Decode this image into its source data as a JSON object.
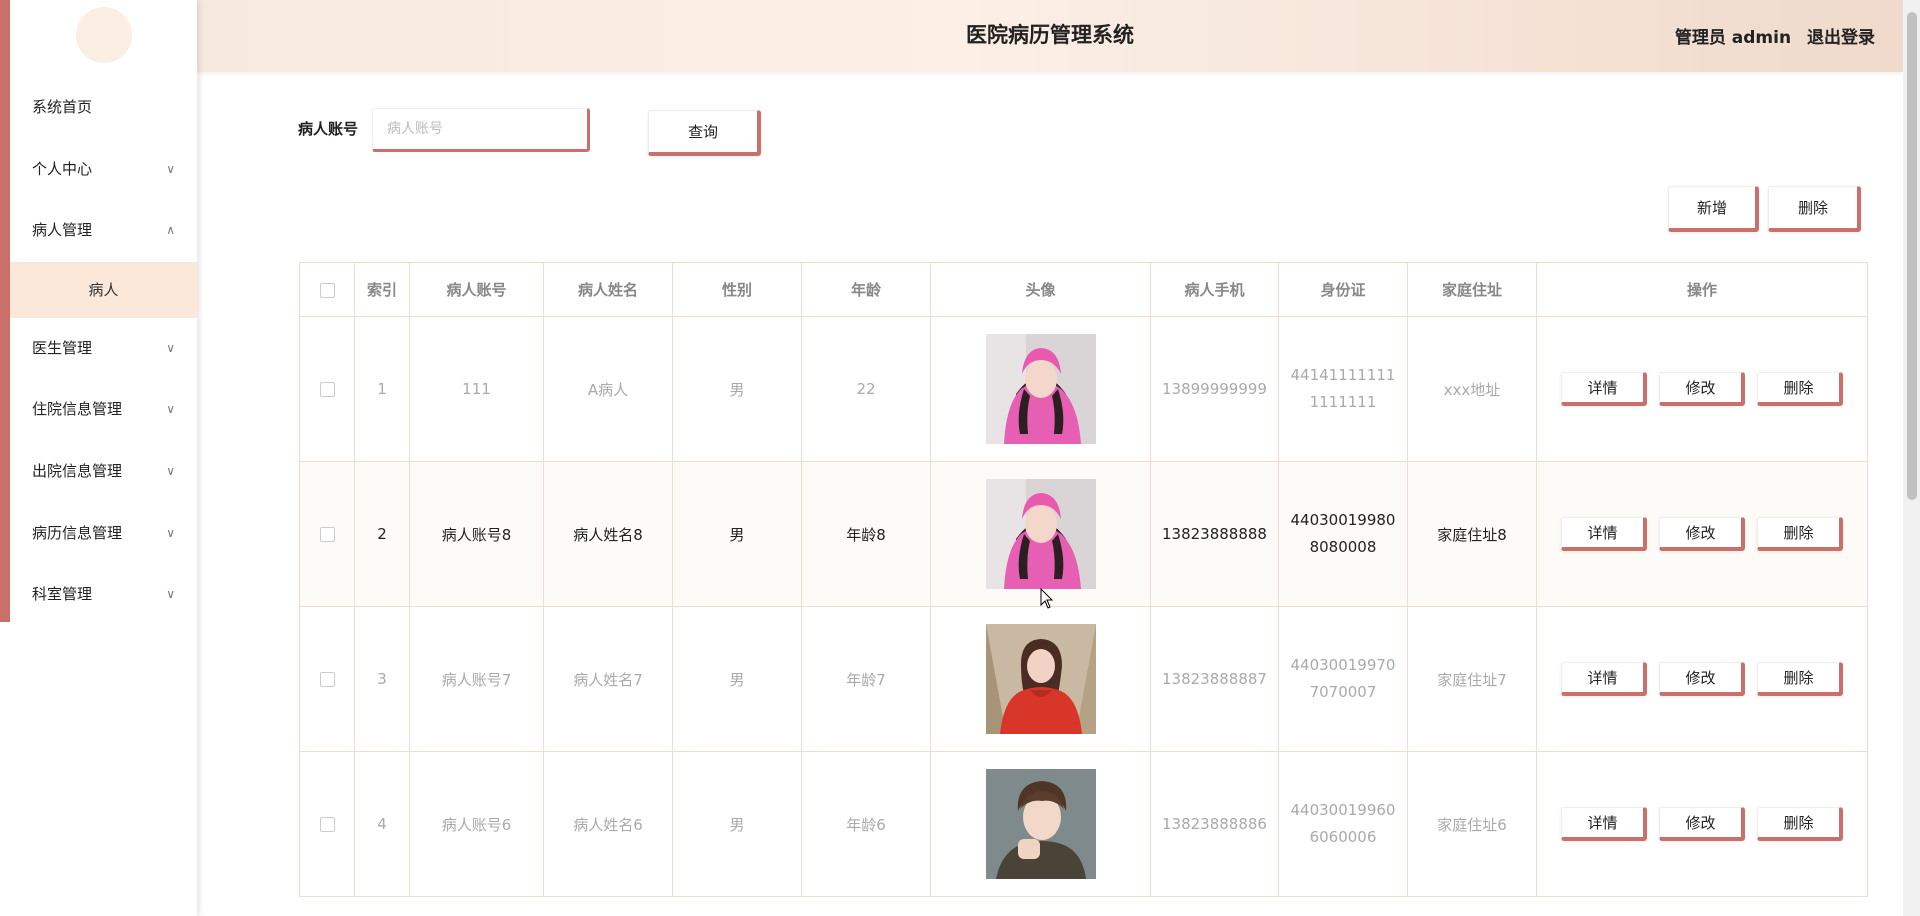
{
  "header": {
    "title": "医院病历管理系统",
    "user_label": "管理员 admin",
    "logout_label": "退出登录"
  },
  "sidebar": {
    "items": [
      {
        "label": "系统首页",
        "expandable": false
      },
      {
        "label": "个人中心",
        "expandable": true,
        "expanded": false
      },
      {
        "label": "病人管理",
        "expandable": true,
        "expanded": true,
        "children": [
          "病人"
        ]
      },
      {
        "label": "医生管理",
        "expandable": true,
        "expanded": false
      },
      {
        "label": "住院信息管理",
        "expandable": true,
        "expanded": false
      },
      {
        "label": "出院信息管理",
        "expandable": true,
        "expanded": false
      },
      {
        "label": "病历信息管理",
        "expandable": true,
        "expanded": false
      },
      {
        "label": "科室管理",
        "expandable": true,
        "expanded": false
      }
    ]
  },
  "search": {
    "label": "病人账号",
    "placeholder": "病人账号",
    "value": "",
    "query_label": "查询"
  },
  "toolbar": {
    "add_label": "新增",
    "delete_label": "删除"
  },
  "table": {
    "columns": [
      "索引",
      "病人账号",
      "病人姓名",
      "性别",
      "年龄",
      "头像",
      "病人手机",
      "身份证",
      "家庭住址",
      "操作"
    ],
    "rows": [
      {
        "index": "1",
        "account": "111",
        "name": "A病人",
        "gender": "男",
        "age": "22",
        "phone": "13899999999",
        "id_card_1": "44141111111",
        "id_card_2": "1111111",
        "address": "xxx地址",
        "avatar": "girl-pink-hoodie"
      },
      {
        "index": "2",
        "account": "病人账号8",
        "name": "病人姓名8",
        "gender": "男",
        "age": "年龄8",
        "phone": "13823888888",
        "id_card_1": "44030019980",
        "id_card_2": "8080008",
        "address": "家庭住址8",
        "avatar": "girl-pink-hoodie"
      },
      {
        "index": "3",
        "account": "病人账号7",
        "name": "病人姓名7",
        "gender": "男",
        "age": "年龄7",
        "phone": "13823888887",
        "id_card_1": "44030019970",
        "id_card_2": "7070007",
        "address": "家庭住址7",
        "avatar": "girl-red-jacket"
      },
      {
        "index": "4",
        "account": "病人账号6",
        "name": "病人姓名6",
        "gender": "男",
        "age": "年龄6",
        "phone": "13823888886",
        "id_card_1": "44030019960",
        "id_card_2": "6060006",
        "address": "家庭住址6",
        "avatar": "boy-portrait"
      }
    ],
    "actions": {
      "detail": "详情",
      "edit": "修改",
      "delete": "删除"
    }
  },
  "colors": {
    "accent": "#c9706a",
    "header_bg": "#f7e9dd",
    "active_menu_bg": "#fbe8d8"
  }
}
